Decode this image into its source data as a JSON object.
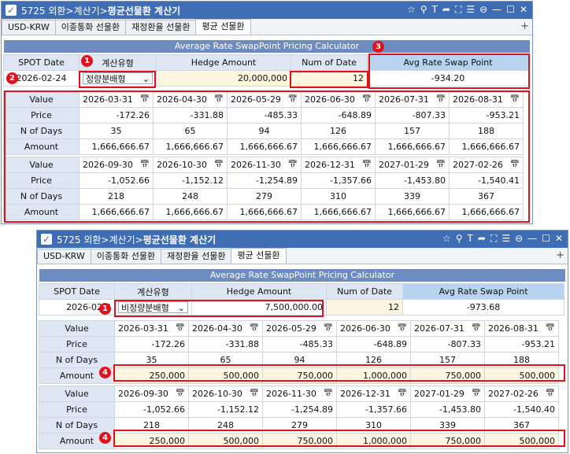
{
  "window1": {
    "title_prefix": "5725 외환>계산기>",
    "title_bold": "평균선물환 계산기",
    "tabs": [
      "USD-KRW",
      "이종통화 선물환",
      "재정환율 선물환",
      "평균 선물환"
    ],
    "banner": "Average Rate SwapPoint Pricing Calculator",
    "headers": {
      "spot_date": "SPOT Date",
      "calc_type": "계산유형",
      "hedge_amount": "Hedge Amount",
      "num_of_date": "Num of Date",
      "avg_rate": "Avg Rate Swap Point"
    },
    "inputs": {
      "spot_date": "2026-02-24",
      "calc_type": "정량분배형",
      "hedge_amount": "20,000,000",
      "num_of_date": "12",
      "avg_rate": "-934.20"
    },
    "row_labels": [
      "Value",
      "Price",
      "N of Days",
      "Amount"
    ],
    "block1": {
      "dates": [
        "2026-03-31",
        "2026-04-30",
        "2026-05-29",
        "2026-06-30",
        "2026-07-31",
        "2026-08-31"
      ],
      "prices": [
        "-172.26",
        "-331.88",
        "-485.33",
        "-648.89",
        "-807.33",
        "-953.21"
      ],
      "days": [
        "35",
        "65",
        "94",
        "126",
        "157",
        "188"
      ],
      "amounts": [
        "1,666,666.67",
        "1,666,666.67",
        "1,666,666.67",
        "1,666,666.67",
        "1,666,666.67",
        "1,666,666.67"
      ]
    },
    "block2": {
      "dates": [
        "2026-09-30",
        "2026-10-30",
        "2026-11-30",
        "2026-12-31",
        "2027-01-29",
        "2027-02-26"
      ],
      "prices": [
        "-1,052.66",
        "-1,152.12",
        "-1,254.89",
        "-1,357.66",
        "-1,453.80",
        "-1,540.41"
      ],
      "days": [
        "218",
        "248",
        "279",
        "310",
        "339",
        "367"
      ],
      "amounts": [
        "1,666,666.67",
        "1,666,666.67",
        "1,666,666.67",
        "1,666,666.67",
        "1,666,666.67",
        "1,666,666.67"
      ]
    },
    "badges": [
      "1",
      "2",
      "3"
    ]
  },
  "window2": {
    "title_prefix": "5725 외환>계산기>",
    "title_bold": "평균선물환 계산기",
    "tabs": [
      "USD-KRW",
      "이종통화 선물환",
      "재정환율 선물환",
      "평균 선물환"
    ],
    "banner": "Average Rate SwapPoint Pricing Calculator",
    "headers": {
      "spot_date": "SPOT Date",
      "calc_type": "계산유형",
      "hedge_amount": "Hedge Amount",
      "num_of_date": "Num of Date",
      "avg_rate": "Avg Rate Swap Point"
    },
    "inputs": {
      "spot_date": "2026-02-2",
      "calc_type": "비정량분배형",
      "hedge_amount": "7,500,000.00",
      "num_of_date": "12",
      "avg_rate": "-973.68"
    },
    "row_labels": [
      "Value",
      "Price",
      "N of Days",
      "Amount"
    ],
    "block1": {
      "dates": [
        "2026-03-31",
        "2026-04-30",
        "2026-05-29",
        "2026-06-30",
        "2026-07-31",
        "2026-08-31"
      ],
      "prices": [
        "-172.26",
        "-331.88",
        "-485.33",
        "-648.89",
        "-807.33",
        "-953.21"
      ],
      "days": [
        "35",
        "65",
        "94",
        "126",
        "157",
        "188"
      ],
      "amounts": [
        "250,000",
        "500,000",
        "750,000",
        "1,000,000",
        "750,000",
        "500,000"
      ]
    },
    "block2": {
      "dates": [
        "2026-09-30",
        "2026-10-30",
        "2026-11-30",
        "2026-12-31",
        "2027-01-29",
        "2027-02-26"
      ],
      "prices": [
        "-1,052.66",
        "-1,152.12",
        "-1,254.89",
        "-1,357.66",
        "-1,453.80",
        "-1,540.40"
      ],
      "days": [
        "218",
        "248",
        "279",
        "310",
        "339",
        "367"
      ],
      "amounts": [
        "250,000",
        "500,000",
        "750,000",
        "1,000,000",
        "750,000",
        "500,000"
      ]
    },
    "badges": [
      "1",
      "4",
      "4"
    ]
  },
  "icons": [
    "checkbox-icon",
    "star-icon",
    "link-off-icon",
    "text-icon",
    "share-icon",
    "expand-icon",
    "list-icon",
    "minimize-circle-icon",
    "minimize-icon",
    "maximize-icon",
    "close-icon",
    "plus-icon",
    "calendar-icon",
    "chevron-down-icon"
  ]
}
